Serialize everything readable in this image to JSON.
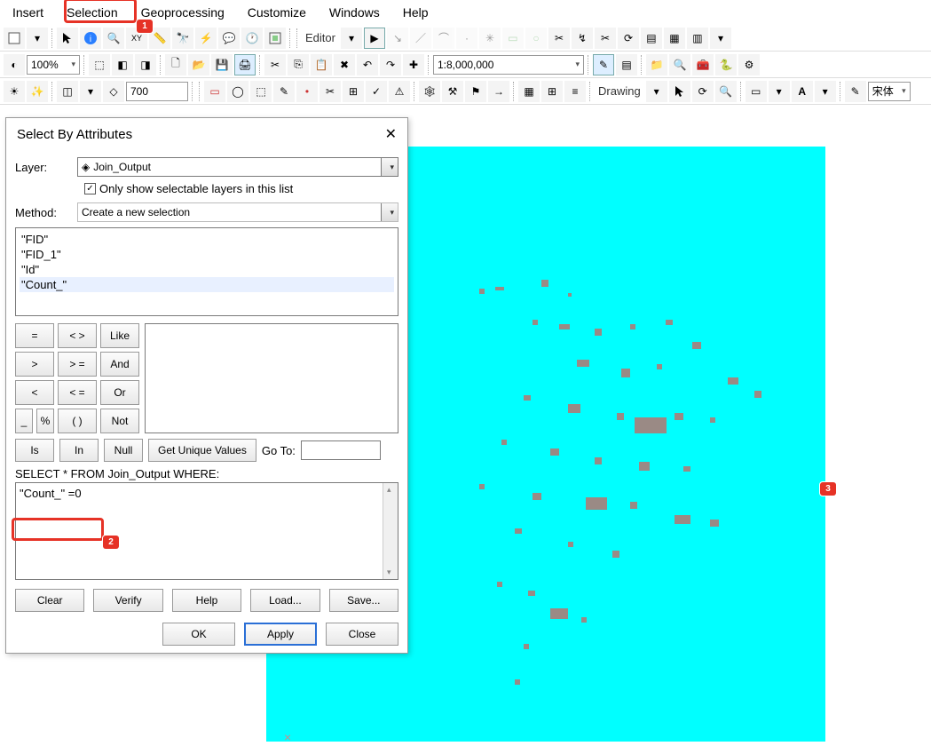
{
  "menu": {
    "items": [
      "Insert",
      "Selection",
      "Geoprocessing",
      "Customize",
      "Windows",
      "Help"
    ]
  },
  "toolbar1": {
    "editor_label": "Editor"
  },
  "toolbar2": {
    "zoom_value": "100%",
    "scale_value": "1:8,000,000"
  },
  "toolbar3": {
    "num_value": "700",
    "drawing_label": "Drawing",
    "font_label": "宋体"
  },
  "dialog": {
    "title": "Select By Attributes",
    "layer_label": "Layer:",
    "layer_value": "Join_Output",
    "only_selectable": "Only show selectable layers in this list",
    "method_label": "Method:",
    "method_value": "Create a new selection",
    "fields": [
      "\"FID\"",
      "\"FID_1\"",
      "\"Id\"",
      "\"Count_\""
    ],
    "ops": [
      "=",
      "< >",
      "Like",
      ">",
      "> =",
      "And",
      "<",
      "< =",
      "Or",
      "_",
      "%",
      "( )",
      "Not"
    ],
    "ops_row5": [
      "Is",
      "In",
      "Null"
    ],
    "unique_btn": "Get Unique Values",
    "goto_label": "Go To:",
    "sql_label": "SELECT * FROM Join_Output WHERE:",
    "sql_text": "\"Count_\" =0",
    "clear": "Clear",
    "verify": "Verify",
    "help": "Help",
    "load": "Load...",
    "save": "Save...",
    "ok": "OK",
    "apply": "Apply",
    "close": "Close"
  },
  "callouts": {
    "c1": "1",
    "c2": "2",
    "c3": "3"
  }
}
